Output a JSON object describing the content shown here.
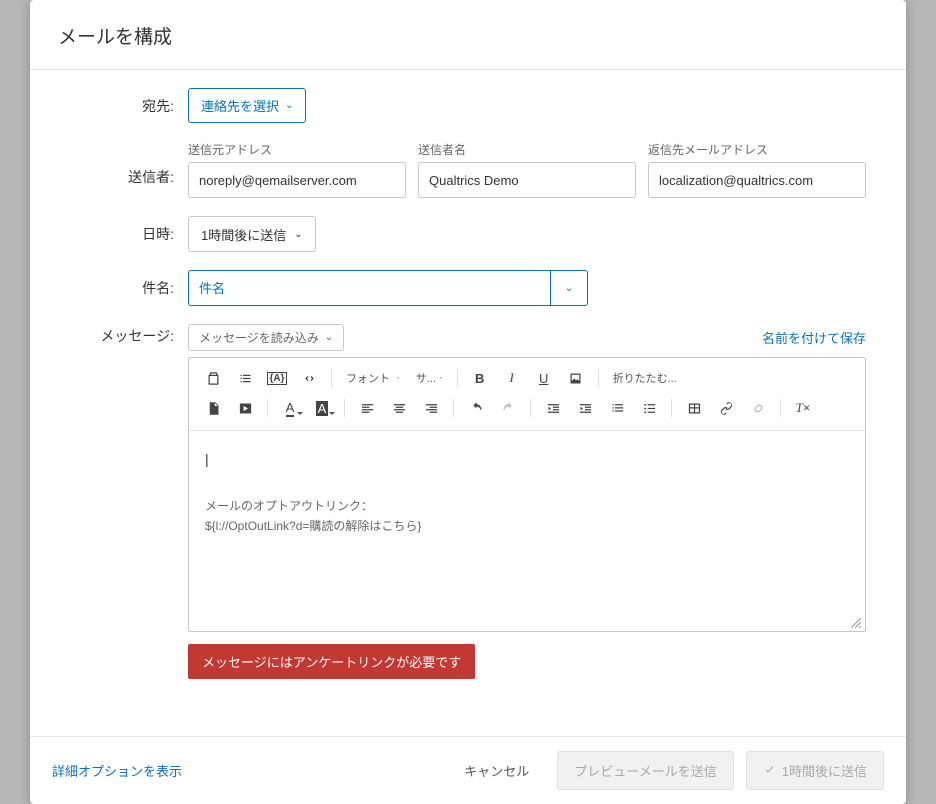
{
  "modal": {
    "title": "メールを構成"
  },
  "labels": {
    "to": "宛先:",
    "from": "送信者:",
    "when": "日時:",
    "subject": "件名:",
    "message": "メッセージ:"
  },
  "to": {
    "select_contacts": "連絡先を選択"
  },
  "from": {
    "from_address_label": "送信元アドレス",
    "from_address_value": "noreply@qemailserver.com",
    "from_name_label": "送信者名",
    "from_name_value": "Qualtrics Demo",
    "reply_to_label": "返信先メールアドレス",
    "reply_to_value": "localization@qualtrics.com"
  },
  "when": {
    "send_in_1_hour": "1時間後に送信"
  },
  "subject": {
    "placeholder": "件名"
  },
  "message": {
    "load_message": "メッセージを読み込み",
    "save_as": "名前を付けて保存",
    "toolbar": {
      "font": "フォント",
      "size": "サ...",
      "more": "折りたたむ..."
    },
    "body": {
      "cursor": "|",
      "opt_out_label": "メールのオプトアウトリンク：",
      "opt_out_code": "${l://OptOutLink?d=購読の解除はこちら}"
    }
  },
  "warning": "メッセージにはアンケートリンクが必要です",
  "footer": {
    "advanced": "詳細オプションを表示",
    "cancel": "キャンセル",
    "preview": "プレビューメールを送信",
    "send": "1時間後に送信"
  }
}
